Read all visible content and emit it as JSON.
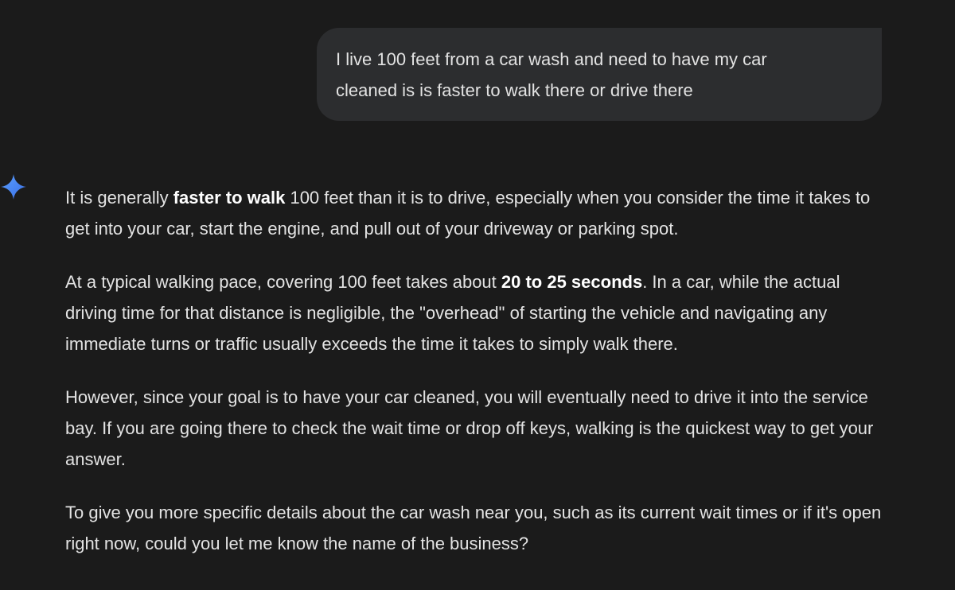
{
  "user_message": {
    "line1": "I live 100 feet from a car wash and need to have my car",
    "line2": "cleaned is is faster to walk there or drive there"
  },
  "assistant": {
    "icon": "gemini-sparkle-icon",
    "paragraphs": [
      {
        "pre": "It is generally ",
        "bold": "faster to walk",
        "post": " 100 feet than it is to drive, especially when you consider the time it takes to get into your car, start the engine, and pull out of your driveway or parking spot."
      },
      {
        "pre": "At a typical walking pace, covering 100 feet takes about ",
        "bold": "20 to 25 seconds",
        "post": ". In a car, while the actual driving time for that distance is negligible, the \"overhead\" of starting the vehicle and navigating any immediate turns or traffic usually exceeds the time it takes to simply walk there."
      },
      {
        "text": "However, since your goal is to have your car cleaned, you will eventually need to drive it into the service bay. If you are going there to check the wait time or drop off keys, walking is the quickest way to get your answer."
      },
      {
        "text": "To give you more specific details about the car wash near you, such as its current wait times or if it's open right now, could you let me know the name of the business?"
      }
    ]
  },
  "colors": {
    "background": "#1b1b1b",
    "bubble": "#2c2d2f",
    "text": "#e3e3e3",
    "icon_gradient_start": "#4f8df7",
    "icon_gradient_end": "#3b6fe0"
  }
}
